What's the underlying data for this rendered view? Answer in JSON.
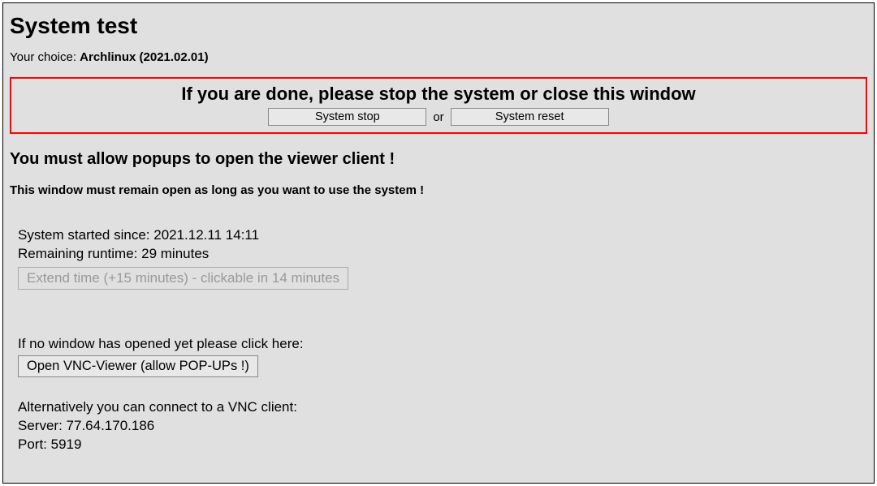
{
  "title": "System test",
  "choice": {
    "prefix": "Your choice: ",
    "value": "Archlinux (2021.02.01)"
  },
  "done_box": {
    "heading": "If you are done, please stop the system or close this window",
    "system_stop_label": "System stop",
    "or_label": "or",
    "system_reset_label": "System reset"
  },
  "popups_heading": "You must allow popups to open the viewer client !",
  "remain_open_text": "This window must remain open as long as you want to use the system !",
  "status": {
    "started_prefix": "System started since: ",
    "started_value": "2021.12.11 14:11",
    "remaining_prefix": "Remaining runtime: ",
    "remaining_value": "29 minutes",
    "extend_label": "Extend time (+15 minutes) - clickable in 14 minutes"
  },
  "vnc": {
    "no_window_text": "If no window has opened yet please click here:",
    "open_viewer_label": "Open VNC-Viewer (allow POP-UPs !)"
  },
  "alt": {
    "text": "Alternatively you can connect to a VNC client:",
    "server_prefix": "Server: ",
    "server_value": "77.64.170.186",
    "port_prefix": "Port: ",
    "port_value": "5919"
  }
}
